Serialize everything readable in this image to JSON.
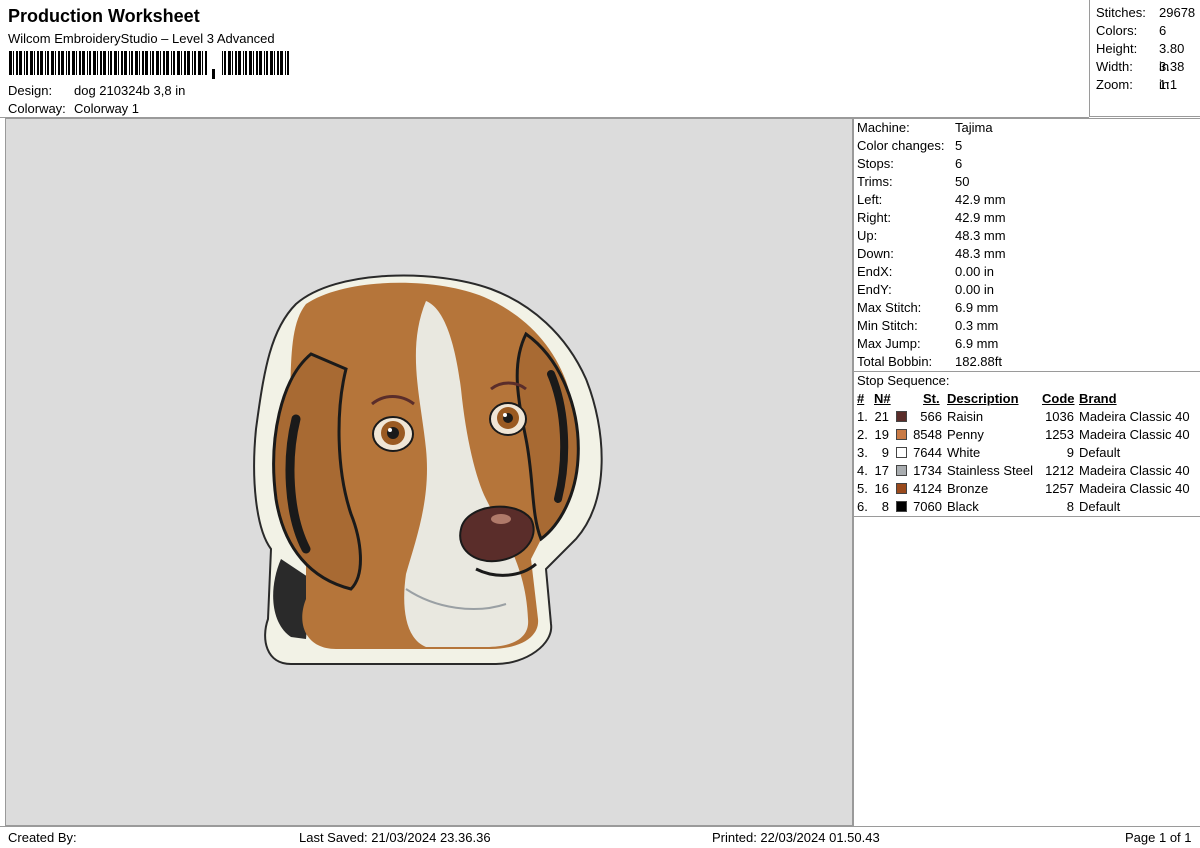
{
  "header": {
    "title": "Production Worksheet",
    "subtitle": "Wilcom EmbroideryStudio – Level 3 Advanced",
    "design_label": "Design:",
    "design_value": "dog 210324b 3,8 in",
    "colorway_label": "Colorway:",
    "colorway_value": "Colorway 1"
  },
  "stats": {
    "stitches_label": "Stitches:",
    "stitches_value": "29678",
    "colors_label": "Colors:",
    "colors_value": "6",
    "height_label": "Height:",
    "height_value": "3.80 in",
    "width_label": "Width:",
    "width_value": "3.38 in",
    "zoom_label": "Zoom:",
    "zoom_value": "1:1"
  },
  "machine": [
    {
      "label": "Machine:",
      "value": "Tajima"
    },
    {
      "label": "Color changes:",
      "value": "5"
    },
    {
      "label": "Stops:",
      "value": "6"
    },
    {
      "label": "Trims:",
      "value": "50"
    },
    {
      "label": "Left:",
      "value": "42.9 mm"
    },
    {
      "label": "Right:",
      "value": "42.9 mm"
    },
    {
      "label": "Up:",
      "value": "48.3 mm"
    },
    {
      "label": "Down:",
      "value": "48.3 mm"
    },
    {
      "label": "EndX:",
      "value": "0.00 in"
    },
    {
      "label": "EndY:",
      "value": "0.00 in"
    },
    {
      "label": "Max Stitch:",
      "value": "6.9 mm"
    },
    {
      "label": "Min Stitch:",
      "value": "0.3 mm"
    },
    {
      "label": "Max Jump:",
      "value": "6.9 mm"
    },
    {
      "label": "Total Bobbin:",
      "value": "182.88ft"
    }
  ],
  "stop_sequence": {
    "title": "Stop Sequence:",
    "headers": {
      "num": "#",
      "n": "N#",
      "st": "St.",
      "desc": "Description",
      "code": "Code",
      "brand": "Brand"
    },
    "rows": [
      {
        "idx": "1.",
        "n": "21",
        "st": "566",
        "desc": "Raisin",
        "code": "1036",
        "brand": "Madeira Classic 40",
        "color": "#5a2d2a"
      },
      {
        "idx": "2.",
        "n": "19",
        "st": "8548",
        "desc": "Penny",
        "code": "1253",
        "brand": "Madeira Classic 40",
        "color": "#c97a45"
      },
      {
        "idx": "3.",
        "n": "9",
        "st": "7644",
        "desc": "White",
        "code": "9",
        "brand": "Default",
        "color": "#ffffff"
      },
      {
        "idx": "4.",
        "n": "17",
        "st": "1734",
        "desc": "Stainless Steel",
        "code": "1212",
        "brand": "Madeira Classic 40",
        "color": "#a9adb0"
      },
      {
        "idx": "5.",
        "n": "16",
        "st": "4124",
        "desc": "Bronze",
        "code": "1257",
        "brand": "Madeira Classic 40",
        "color": "#9a4a1c"
      },
      {
        "idx": "6.",
        "n": "8",
        "st": "7060",
        "desc": "Black",
        "code": "8",
        "brand": "Default",
        "color": "#000000"
      }
    ]
  },
  "footer": {
    "created_by": "Created By:",
    "last_saved": "Last Saved: 21/03/2024 23.36.36",
    "printed": "Printed: 22/03/2024 01.50.43",
    "page": "Page 1 of 1"
  }
}
